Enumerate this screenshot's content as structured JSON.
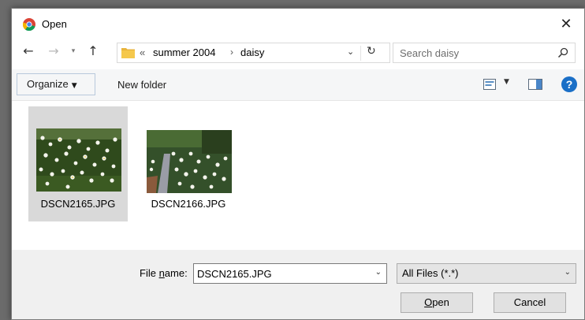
{
  "window": {
    "title": "Open",
    "close_glyph": "✕",
    "app_icon": "chrome-icon"
  },
  "nav": {
    "back_glyph": "←",
    "forward_glyph": "→",
    "recent_glyph": "▾",
    "up_glyph": "↑"
  },
  "address": {
    "overflow_glyph": "«",
    "crumbs": [
      "summer 2004",
      "daisy"
    ],
    "separator_glyph": "›",
    "dropdown_glyph": "⌄",
    "refresh_glyph": "↻"
  },
  "search": {
    "placeholder": "Search daisy"
  },
  "toolbar": {
    "organize_label": "Organize",
    "organize_caret": "▼",
    "new_folder_label": "New folder",
    "view_caret": "▼",
    "help_glyph": "?"
  },
  "files": [
    {
      "name": "DSCN2165.JPG",
      "selected": true
    },
    {
      "name": "DSCN2166.JPG",
      "selected": false
    }
  ],
  "bottom": {
    "file_name_label_prefix": "File ",
    "file_name_label_underlined": "n",
    "file_name_label_suffix": "ame:",
    "file_name_value": "DSCN2165.JPG",
    "dropdown_glyph": "⌄",
    "filter_value": "All Files (*.*)",
    "open_label_underlined": "O",
    "open_label_rest": "pen",
    "cancel_label": "Cancel"
  },
  "colors": {
    "accent_blue": "#1a6fc7",
    "selection_gray": "#d9d9d9",
    "folder_yellow": "#f5c84c"
  }
}
